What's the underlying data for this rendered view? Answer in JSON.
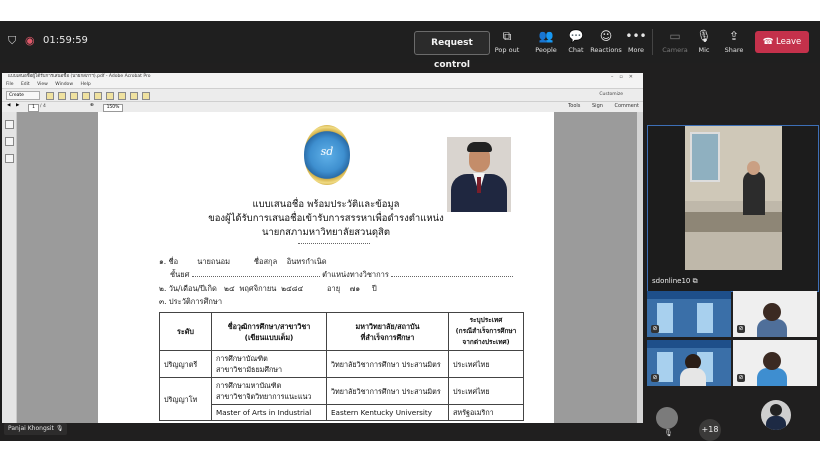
{
  "meeting": {
    "timer": "01:59:59",
    "request_control": "Request control",
    "tools": [
      {
        "icon": "pop-out-icon",
        "label": "Pop out"
      },
      {
        "icon": "people-icon",
        "label": "People"
      },
      {
        "icon": "chat-icon",
        "label": "Chat"
      },
      {
        "icon": "reactions-icon",
        "label": "Reactions"
      },
      {
        "icon": "more-icon",
        "label": "More"
      },
      {
        "icon": "camera-off-icon",
        "label": "Camera"
      },
      {
        "icon": "mic-icon",
        "label": "Mic"
      },
      {
        "icon": "share-icon",
        "label": "Share"
      }
    ],
    "leave_label": "Leave",
    "leave_color": "#c4314b",
    "presenter_name": "Panjai Khongsit",
    "main_participant": "sdonline10",
    "overflow_count": "+18"
  },
  "acrobat": {
    "title": "แบบเสนอชื่อผู้ได้รับการเสนอชื่อ (นายกสภาฯ).pdf - Adobe Acrobat Pro",
    "menu": [
      "File",
      "Edit",
      "View",
      "Window",
      "Help"
    ],
    "create_label": "Create",
    "customize_label": "Customize",
    "page_num": "1",
    "page_of": "/ 4",
    "zoom": "150%",
    "right_links": [
      "Tools",
      "Sign",
      "Comment"
    ]
  },
  "doc": {
    "heading1": "แบบเสนอชื่อ พร้อมประวัติและข้อมูล",
    "heading2": "ของผู้ได้รับการเสนอชื่อเข้ารับการสรรหาเพื่อดำรงตำแหน่ง",
    "heading3": "นายกสภามหาวิทยาลัยสวนดุสิต",
    "line_name": "๑. ชื่อ        นายถนอม          ชื่อสกุล    อินทรกำเนิด",
    "line_rank_label": "ชั้นยศ",
    "line_position_label": "ตำแหน่งทางวิชาการ",
    "line_birth": "๒. วัน/เดือน/ปีเกิด   ๒๔  พฤศจิกายน  ๒๔๘๔          อายุ    ๗๑     ปี",
    "line_edu": "๓. ประวัติการศึกษา",
    "table_headers": [
      "ระดับ",
      "ชื่อวุฒิการศึกษา/สาขาวิชา\n(เขียนแบบเต็ม)",
      "มหาวิทยาลัย/สถาบัน\nที่สำเร็จการศึกษา",
      "ระบุประเทศ\n(กรณีสำเร็จการศึกษา\nจากต่างประเทศ)"
    ],
    "rows": [
      {
        "level": "ปริญญาตรี",
        "degree": "การศึกษาบัณฑิต\nสาขาวิชามัธยมศึกษา",
        "inst": "วิทยาลัยวิชาการศึกษา ประสานมิตร",
        "country": "ประเทศไทย"
      },
      {
        "level": "ปริญญาโท",
        "degree": "การศึกษามหาบัณฑิต\nสาขาวิชาจิตวิทยาการแนะแนว",
        "inst": "วิทยาลัยวิชาการศึกษา ประสานมิตร",
        "country": "ประเทศไทย"
      },
      {
        "level": "",
        "degree": "Master of Arts in Industrial",
        "inst": "Eastern Kentucky University",
        "country": "สหรัฐอเมริกา"
      }
    ]
  }
}
